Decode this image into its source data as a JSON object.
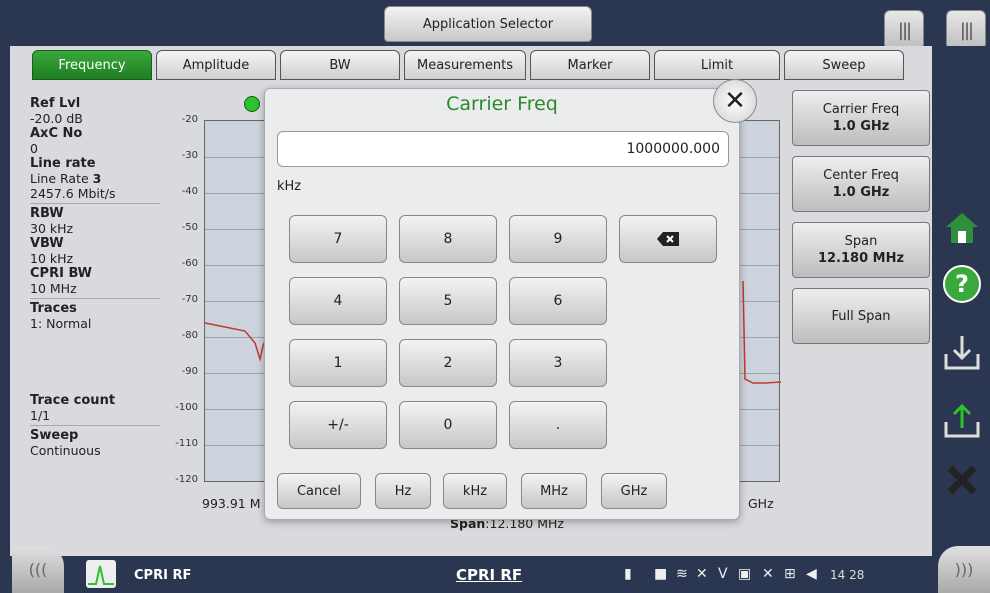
{
  "app_selector": {
    "label": "Application Selector"
  },
  "tabs": [
    {
      "label": "Frequency"
    },
    {
      "label": "Amplitude"
    },
    {
      "label": "BW"
    },
    {
      "label": "Measurements"
    },
    {
      "label": "Marker"
    },
    {
      "label": "Limit"
    },
    {
      "label": "Sweep"
    }
  ],
  "info": {
    "ref_lvl_key": "Ref Lvl",
    "ref_lvl_val": "-20.0 dB",
    "axc_key": "AxC No",
    "axc_val": "0",
    "line_rate_key": "Line rate",
    "line_rate_val_prefix": "Line Rate ",
    "line_rate_val_num": "3",
    "line_rate_speed": "2457.6 Mbit/s",
    "rbw_key": "RBW",
    "rbw_val": "30 kHz",
    "vbw_key": "VBW",
    "vbw_val": "10 kHz",
    "cpri_bw_key": "CPRI BW",
    "cpri_bw_val": "10 MHz",
    "traces_key": "Traces",
    "traces_val": "1: Normal",
    "trace_count_key": "Trace count",
    "trace_count_val": "1/1",
    "sweep_key": "Sweep",
    "sweep_val": "Continuous"
  },
  "plot": {
    "y_ticks": [
      "-20",
      "-30",
      "-40",
      "-50",
      "-60",
      "-70",
      "-80",
      "-90",
      "-100",
      "-110",
      "-120"
    ],
    "x_start_label": "993.91 M",
    "x_end_label": "GHz",
    "span_key": "Span",
    "span_val": ":12.180 MHz"
  },
  "softkeys": [
    {
      "label": "Carrier Freq",
      "value": "1.0 GHz"
    },
    {
      "label": "Center Freq",
      "value": "1.0 GHz"
    },
    {
      "label": "Span",
      "value": "12.180 MHz"
    },
    {
      "label": "Full Span",
      "value": ""
    }
  ],
  "dialog": {
    "title": "Carrier Freq",
    "value": "1000000.000",
    "unit": "kHz",
    "keys": [
      "7",
      "8",
      "9",
      "4",
      "5",
      "6",
      "1",
      "2",
      "3",
      "+/-",
      "0",
      "."
    ],
    "cancel_label": "Cancel",
    "units": [
      "Hz",
      "kHz",
      "MHz",
      "GHz"
    ]
  },
  "statusbar": {
    "app_name": "CPRI RF",
    "center_title": "CPRI RF",
    "time": "14 28"
  },
  "colors": {
    "accent_green": "#2a8a2a",
    "frame": "#2b3650",
    "trace": "#c23a2a",
    "help_green": "#3aa83a"
  }
}
